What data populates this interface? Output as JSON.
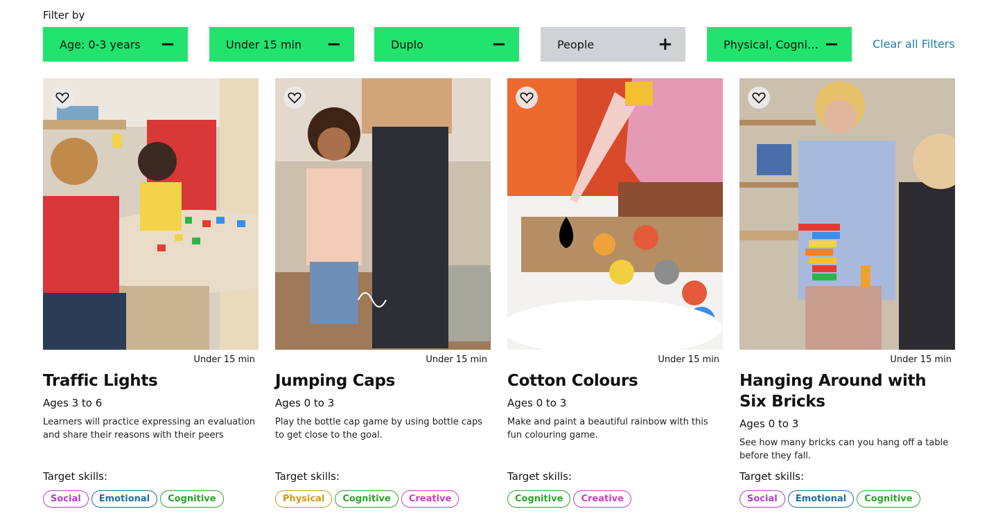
{
  "filter_title": "Filter by",
  "filters": [
    {
      "label": "Age: 0-3 years",
      "symbol": "−",
      "active": true
    },
    {
      "label": "Under 15 min",
      "symbol": "−",
      "active": true
    },
    {
      "label": "Duplo",
      "symbol": "−",
      "active": true
    },
    {
      "label": "People",
      "symbol": "+",
      "active": false
    },
    {
      "label": "Physical, Cogniti...",
      "symbol": "−",
      "active": true
    }
  ],
  "clear_filters": "Clear all Filters",
  "colors": {
    "active_chip": "#22e36e",
    "inactive_chip": "#d1d2d6",
    "link": "#1a7fa8",
    "skill_social": "#b23ccc",
    "skill_emotional": "#1a6fa0",
    "skill_cognitive": "#2aa52a",
    "skill_physical": "#d09a1a",
    "skill_creative": "#d03cc0"
  },
  "cards": [
    {
      "duration": "Under 15 min",
      "title": "Traffic Lights",
      "ages": "Ages 3 to 6",
      "description": "Learners will practice expressing an evaluation and share their reasons with their peers",
      "skills_label": "Target skills:",
      "skills": [
        "Social",
        "Emotional",
        "Cognitive"
      ],
      "image": "children-playing-with-blocks-at-table"
    },
    {
      "duration": "Under 15 min",
      "title": "Jumping Caps",
      "ages": "Ages 0 to 3",
      "description": "Play the bottle cap game by using bottle caps to get close to the goal.",
      "skills_label": "Target skills:",
      "skills": [
        "Physical",
        "Cognitive",
        "Creative"
      ],
      "image": "girl-tossing-bottle-cap"
    },
    {
      "duration": "Under 15 min",
      "title": "Cotton Colours",
      "ages": "Ages 0 to 3",
      "description": "Make and paint a beautiful rainbow with this fun colouring game.",
      "skills_label": "Target skills:",
      "skills": [
        "Cognitive",
        "Creative"
      ],
      "image": "dropper-painting-cotton-balls"
    },
    {
      "duration": "Under 15 min",
      "title": "Hanging Around with Six Bricks",
      "ages": "Ages 0 to 3",
      "description": "See how many bricks can you hang off a table before they fall.",
      "skills_label": "Target skills:",
      "skills": [
        "Social",
        "Emotional",
        "Cognitive"
      ],
      "image": "woman-hanging-bricks-off-table"
    }
  ]
}
